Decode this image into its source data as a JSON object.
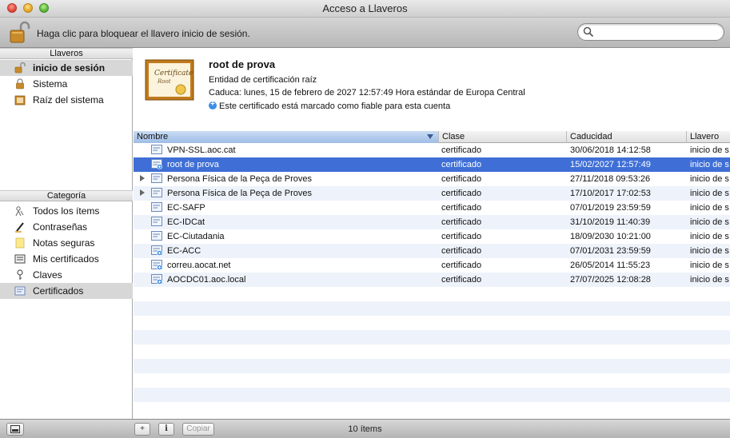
{
  "window": {
    "title": "Acceso a Llaveros"
  },
  "toolbar": {
    "lock_text": "Haga clic para bloquear el llavero inicio de sesión.",
    "search_placeholder": "",
    "lock_icon": "open-padlock-icon",
    "search_icon": "magnifier-icon"
  },
  "sidebar": {
    "keychains_header": "Llaveros",
    "keychains": [
      {
        "label": "inicio de sesión",
        "icon": "open-padlock-icon",
        "selected": true
      },
      {
        "label": "Sistema",
        "icon": "padlock-icon",
        "selected": false
      },
      {
        "label": "Raíz del sistema",
        "icon": "cabinet-icon",
        "selected": false
      }
    ],
    "category_header": "Categoría",
    "categories": [
      {
        "label": "Todos los ítems",
        "icon": "people-icon",
        "selected": false
      },
      {
        "label": "Contraseñas",
        "icon": "pencil-icon",
        "selected": false
      },
      {
        "label": "Notas seguras",
        "icon": "note-icon",
        "selected": false
      },
      {
        "label": "Mis certificados",
        "icon": "id-card-icon",
        "selected": false
      },
      {
        "label": "Claves",
        "icon": "key-icon",
        "selected": false
      },
      {
        "label": "Certificados",
        "icon": "certificate-icon",
        "selected": true
      }
    ]
  },
  "detail": {
    "thumb_title": "Certificate",
    "thumb_subtitle": "Root",
    "name": "root de prova",
    "type": "Entidad de certificación raíz",
    "expiry": "Caduca: lunes, 15 de febrero de 2027 12:57:49 Hora estándar de Europa Central",
    "trust": "Este certificado está marcado como fiable para esta cuenta"
  },
  "table": {
    "columns": [
      "Nombre",
      "Clase",
      "Caducidad",
      "Llavero"
    ],
    "rows": [
      {
        "name": "VPN-SSL.aoc.cat",
        "class": "certificado",
        "expiry": "30/06/2018 14:12:58",
        "keychain": "inicio de s",
        "expandable": false,
        "root": false,
        "selected": false
      },
      {
        "name": "root de prova",
        "class": "certificado",
        "expiry": "15/02/2027 12:57:49",
        "keychain": "inicio de s",
        "expandable": false,
        "root": true,
        "selected": true
      },
      {
        "name": "Persona Física de la Peça de Proves",
        "class": "certificado",
        "expiry": "27/11/2018 09:53:26",
        "keychain": "inicio de s",
        "expandable": true,
        "root": false,
        "selected": false
      },
      {
        "name": "Persona Física de la Peça de Proves",
        "class": "certificado",
        "expiry": "17/10/2017 17:02:53",
        "keychain": "inicio de s",
        "expandable": true,
        "root": false,
        "selected": false
      },
      {
        "name": "EC-SAFP",
        "class": "certificado",
        "expiry": "07/01/2019 23:59:59",
        "keychain": "inicio de s",
        "expandable": false,
        "root": false,
        "selected": false
      },
      {
        "name": "EC-IDCat",
        "class": "certificado",
        "expiry": "31/10/2019 11:40:39",
        "keychain": "inicio de s",
        "expandable": false,
        "root": false,
        "selected": false
      },
      {
        "name": "EC-Ciutadania",
        "class": "certificado",
        "expiry": "18/09/2030 10:21:00",
        "keychain": "inicio de s",
        "expandable": false,
        "root": false,
        "selected": false
      },
      {
        "name": "EC-ACC",
        "class": "certificado",
        "expiry": "07/01/2031 23:59:59",
        "keychain": "inicio de s",
        "expandable": false,
        "root": true,
        "selected": false
      },
      {
        "name": "correu.aocat.net",
        "class": "certificado",
        "expiry": "26/05/2014 11:55:23",
        "keychain": "inicio de s",
        "expandable": false,
        "root": true,
        "selected": false
      },
      {
        "name": "AOCDC01.aoc.local",
        "class": "certificado",
        "expiry": "27/07/2025 12:08:28",
        "keychain": "inicio de s",
        "expandable": false,
        "root": true,
        "selected": false
      }
    ]
  },
  "bottombar": {
    "add_label": "+",
    "info_label": "i",
    "copy_label": "Copiar",
    "status": "10 ítems"
  },
  "colors": {
    "selection": "#3f6fd6",
    "alt_row": "#eef3fb",
    "sidebar_selected": "#d7d7d7"
  }
}
